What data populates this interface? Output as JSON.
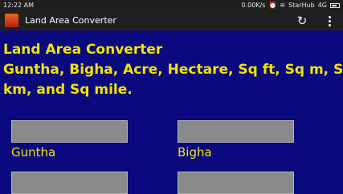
{
  "status_bar": {
    "time": "12:22 AM",
    "network_speed": "0.00K/s",
    "carrier": "StarHub",
    "network_type": "4G"
  },
  "action_bar": {
    "title": "Land Area Converter"
  },
  "heading": {
    "line1": "Land Area Converter",
    "line2": "Guntha, Bigha, Acre, Hectare, Sq ft, Sq m, Sq",
    "line3": "km, and Sq mile."
  },
  "fields": [
    {
      "label": "Guntha",
      "value": ""
    },
    {
      "label": "Bigha",
      "value": ""
    },
    {
      "label": "",
      "value": ""
    },
    {
      "label": "",
      "value": ""
    }
  ],
  "colors": {
    "background": "#0a0a7e",
    "accent_text": "#f2e300",
    "input_fill": "#8a8a8a",
    "action_bar": "#202020"
  }
}
